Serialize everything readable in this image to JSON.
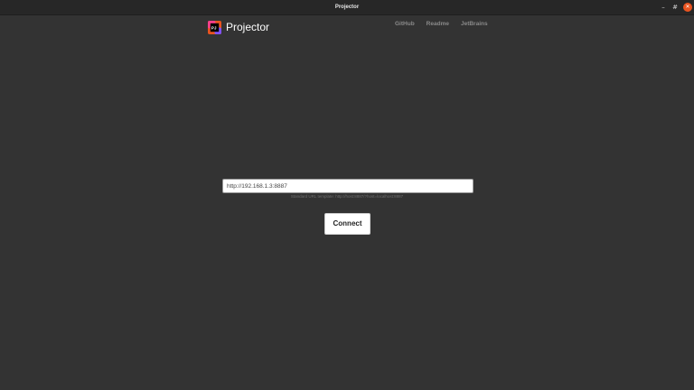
{
  "window": {
    "title": "Projector",
    "minimize_glyph": "–",
    "maximize_glyph": "#",
    "close_glyph": "✕",
    "close_color": "#e95420"
  },
  "header": {
    "brand": "Projector",
    "logo_icon": "projector-logo-icon",
    "nav": [
      "GitHub",
      "Readme",
      "JetBrains"
    ]
  },
  "form": {
    "url_value": "http://192.168.1.3:8887",
    "hint": "Standard URL template: http://host:8887/?host=localhost:8887",
    "connect_label": "Connect"
  }
}
